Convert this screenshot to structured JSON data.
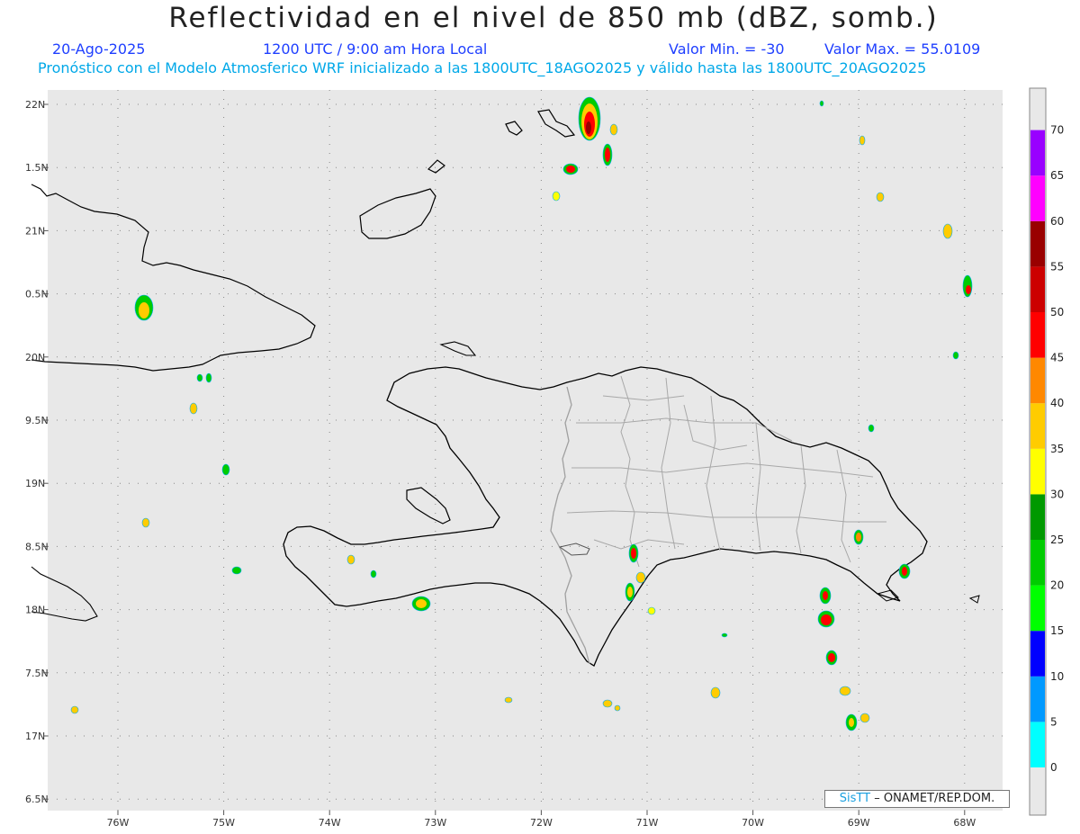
{
  "title": "Reflectividad en el nivel de 850 mb (dBZ, somb.)",
  "date": "20-Ago-2025",
  "time": "1200 UTC / 9:00 am Hora Local",
  "valor_min": "Valor Min. = -30",
  "valor_max": "Valor Max. = 55.0109",
  "init_line": "Pronóstico con el Modelo Atmosferico WRF inicializado a las 1800UTC_18AGO2025 y válido hasta las  1800UTC_20AGO2025",
  "lat_labels": [
    "22N",
    "1.5N",
    "21N",
    "0.5N",
    "20N",
    "9.5N",
    "19N",
    "8.5N",
    "18N",
    "7.5N",
    "17N",
    "6.5N"
  ],
  "lon_labels": [
    "76W",
    "75W",
    "74W",
    "73W",
    "72W",
    "71W",
    "70W",
    "69W",
    "68W"
  ],
  "colorbar": {
    "ticks": [
      "0",
      "5",
      "10",
      "15",
      "20",
      "25",
      "30",
      "35",
      "40",
      "45",
      "50",
      "55",
      "60",
      "65",
      "70"
    ],
    "colors": [
      "#00ffff",
      "#0099ff",
      "#0000ff",
      "#00ff00",
      "#00cc00",
      "#009900",
      "#ffff00",
      "#ffcc00",
      "#ff8800",
      "#ff0000",
      "#cc0000",
      "#990000",
      "#ff00ff",
      "#9900ff"
    ]
  },
  "credit": {
    "logo": "SisTT",
    "text": "– ONAMET/REP.DOM."
  },
  "colors": {
    "map_bg": "#e8e8e8",
    "grid": "#888888",
    "coast": "#000000",
    "border": "#a0a0a0"
  }
}
